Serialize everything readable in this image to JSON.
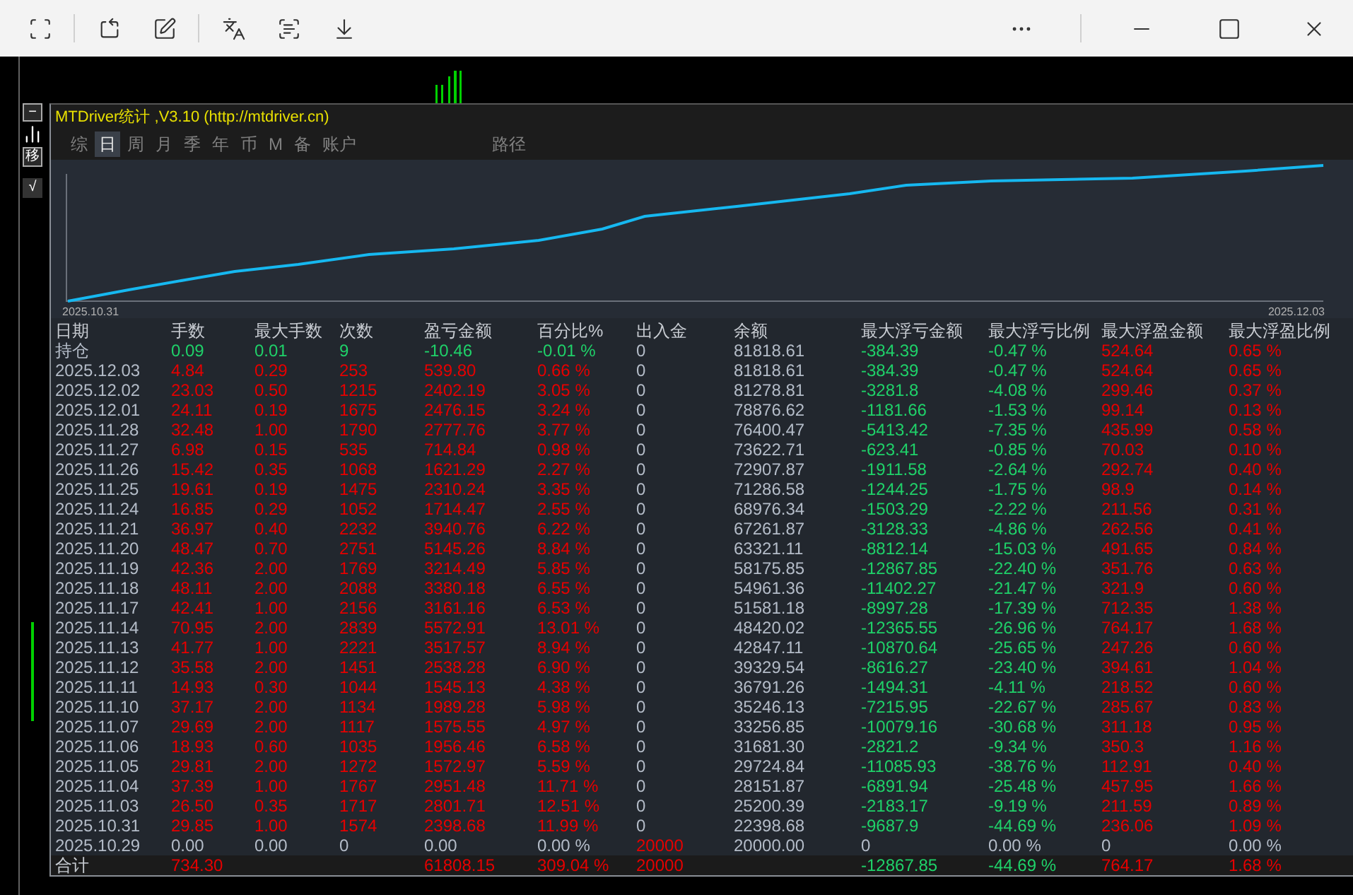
{
  "left_tools": [
    "−",
    "移",
    "√"
  ],
  "panel": {
    "title": "MTDriver统计 ,V3.10 (http://mtdriver.cn)",
    "tabs": [
      {
        "label": "综",
        "selected": false
      },
      {
        "label": "日",
        "selected": true
      },
      {
        "label": "周",
        "selected": false
      },
      {
        "label": "月",
        "selected": false
      },
      {
        "label": "季",
        "selected": false
      },
      {
        "label": "年",
        "selected": false
      },
      {
        "label": "币",
        "selected": false
      },
      {
        "label": "M",
        "selected": false
      },
      {
        "label": "备",
        "selected": false
      },
      {
        "label": "账户",
        "selected": false
      }
    ],
    "path_button": "路径",
    "equity_chart": {
      "start_label": "2025.10.31",
      "end_label": "2025.12.03"
    }
  },
  "table": {
    "columns": [
      "日期",
      "手数",
      "最大手数",
      "次数",
      "盈亏金额",
      "百分比%",
      "出入金",
      "余额",
      "最大浮亏金额",
      "最大浮亏比例",
      "最大浮盈金额",
      "最大浮盈比例"
    ],
    "rows": [
      {
        "kind": "position",
        "cells": [
          "持仓",
          "0.09",
          "0.01",
          "9",
          "-10.46",
          "-0.01 %",
          "0",
          "81818.61",
          "-384.39",
          "-0.47 %",
          "524.64",
          "0.65 %"
        ]
      },
      {
        "kind": "day",
        "cells": [
          "2025.12.03",
          "4.84",
          "0.29",
          "253",
          "539.80",
          "0.66 %",
          "0",
          "81818.61",
          "-384.39",
          "-0.47 %",
          "524.64",
          "0.65 %"
        ]
      },
      {
        "kind": "day",
        "cells": [
          "2025.12.02",
          "23.03",
          "0.50",
          "1215",
          "2402.19",
          "3.05 %",
          "0",
          "81278.81",
          "-3281.8",
          "-4.08 %",
          "299.46",
          "0.37 %"
        ]
      },
      {
        "kind": "day",
        "cells": [
          "2025.12.01",
          "24.11",
          "0.19",
          "1675",
          "2476.15",
          "3.24 %",
          "0",
          "78876.62",
          "-1181.66",
          "-1.53 %",
          "99.14",
          "0.13 %"
        ]
      },
      {
        "kind": "day",
        "cells": [
          "2025.11.28",
          "32.48",
          "1.00",
          "1790",
          "2777.76",
          "3.77 %",
          "0",
          "76400.47",
          "-5413.42",
          "-7.35 %",
          "435.99",
          "0.58 %"
        ]
      },
      {
        "kind": "day",
        "cells": [
          "2025.11.27",
          "6.98",
          "0.15",
          "535",
          "714.84",
          "0.98 %",
          "0",
          "73622.71",
          "-623.41",
          "-0.85 %",
          "70.03",
          "0.10 %"
        ]
      },
      {
        "kind": "day",
        "cells": [
          "2025.11.26",
          "15.42",
          "0.35",
          "1068",
          "1621.29",
          "2.27 %",
          "0",
          "72907.87",
          "-1911.58",
          "-2.64 %",
          "292.74",
          "0.40 %"
        ]
      },
      {
        "kind": "day",
        "cells": [
          "2025.11.25",
          "19.61",
          "0.19",
          "1475",
          "2310.24",
          "3.35 %",
          "0",
          "71286.58",
          "-1244.25",
          "-1.75 %",
          "98.9",
          "0.14 %"
        ]
      },
      {
        "kind": "day",
        "cells": [
          "2025.11.24",
          "16.85",
          "0.29",
          "1052",
          "1714.47",
          "2.55 %",
          "0",
          "68976.34",
          "-1503.29",
          "-2.22 %",
          "211.56",
          "0.31 %"
        ]
      },
      {
        "kind": "day",
        "cells": [
          "2025.11.21",
          "36.97",
          "0.40",
          "2232",
          "3940.76",
          "6.22 %",
          "0",
          "67261.87",
          "-3128.33",
          "-4.86 %",
          "262.56",
          "0.41 %"
        ]
      },
      {
        "kind": "day",
        "cells": [
          "2025.11.20",
          "48.47",
          "0.70",
          "2751",
          "5145.26",
          "8.84 %",
          "0",
          "63321.11",
          "-8812.14",
          "-15.03 %",
          "491.65",
          "0.84 %"
        ]
      },
      {
        "kind": "day",
        "cells": [
          "2025.11.19",
          "42.36",
          "2.00",
          "1769",
          "3214.49",
          "5.85 %",
          "0",
          "58175.85",
          "-12867.85",
          "-22.40 %",
          "351.76",
          "0.63 %"
        ]
      },
      {
        "kind": "day",
        "cells": [
          "2025.11.18",
          "48.11",
          "2.00",
          "2088",
          "3380.18",
          "6.55 %",
          "0",
          "54961.36",
          "-11402.27",
          "-21.47 %",
          "321.9",
          "0.60 %"
        ]
      },
      {
        "kind": "day",
        "cells": [
          "2025.11.17",
          "42.41",
          "1.00",
          "2156",
          "3161.16",
          "6.53 %",
          "0",
          "51581.18",
          "-8997.28",
          "-17.39 %",
          "712.35",
          "1.38 %"
        ]
      },
      {
        "kind": "day",
        "cells": [
          "2025.11.14",
          "70.95",
          "2.00",
          "2839",
          "5572.91",
          "13.01 %",
          "0",
          "48420.02",
          "-12365.55",
          "-26.96 %",
          "764.17",
          "1.68 %"
        ]
      },
      {
        "kind": "day",
        "cells": [
          "2025.11.13",
          "41.77",
          "1.00",
          "2221",
          "3517.57",
          "8.94 %",
          "0",
          "42847.11",
          "-10870.64",
          "-25.65 %",
          "247.26",
          "0.60 %"
        ]
      },
      {
        "kind": "day",
        "cells": [
          "2025.11.12",
          "35.58",
          "2.00",
          "1451",
          "2538.28",
          "6.90 %",
          "0",
          "39329.54",
          "-8616.27",
          "-23.40 %",
          "394.61",
          "1.04 %"
        ]
      },
      {
        "kind": "day",
        "cells": [
          "2025.11.11",
          "14.93",
          "0.30",
          "1044",
          "1545.13",
          "4.38 %",
          "0",
          "36791.26",
          "-1494.31",
          "-4.11 %",
          "218.52",
          "0.60 %"
        ]
      },
      {
        "kind": "day",
        "cells": [
          "2025.11.10",
          "37.17",
          "2.00",
          "1134",
          "1989.28",
          "5.98 %",
          "0",
          "35246.13",
          "-7215.95",
          "-22.67 %",
          "285.67",
          "0.83 %"
        ]
      },
      {
        "kind": "day",
        "cells": [
          "2025.11.07",
          "29.69",
          "2.00",
          "1117",
          "1575.55",
          "4.97 %",
          "0",
          "33256.85",
          "-10079.16",
          "-30.68 %",
          "311.18",
          "0.95 %"
        ]
      },
      {
        "kind": "day",
        "cells": [
          "2025.11.06",
          "18.93",
          "0.60",
          "1035",
          "1956.46",
          "6.58 %",
          "0",
          "31681.30",
          "-2821.2",
          "-9.34 %",
          "350.3",
          "1.16 %"
        ]
      },
      {
        "kind": "day",
        "cells": [
          "2025.11.05",
          "29.81",
          "2.00",
          "1272",
          "1572.97",
          "5.59 %",
          "0",
          "29724.84",
          "-11085.93",
          "-38.76 %",
          "112.91",
          "0.40 %"
        ]
      },
      {
        "kind": "day",
        "cells": [
          "2025.11.04",
          "37.39",
          "1.00",
          "1767",
          "2951.48",
          "11.71 %",
          "0",
          "28151.87",
          "-6891.94",
          "-25.48 %",
          "457.95",
          "1.66 %"
        ]
      },
      {
        "kind": "day",
        "cells": [
          "2025.11.03",
          "26.50",
          "0.35",
          "1717",
          "2801.71",
          "12.51 %",
          "0",
          "25200.39",
          "-2183.17",
          "-9.19 %",
          "211.59",
          "0.89 %"
        ]
      },
      {
        "kind": "day",
        "cells": [
          "2025.10.31",
          "29.85",
          "1.00",
          "1574",
          "2398.68",
          "11.99 %",
          "0",
          "22398.68",
          "-9687.9",
          "-44.69 %",
          "236.06",
          "1.09 %"
        ]
      },
      {
        "kind": "start",
        "cells": [
          "2025.10.29",
          "0.00",
          "0.00",
          "0",
          "0.00",
          "0.00 %",
          "20000",
          "20000.00",
          "0",
          "0.00 %",
          "0",
          "0.00 %"
        ]
      },
      {
        "kind": "total",
        "cells": [
          "合计",
          "734.30",
          null,
          null,
          "61808.15",
          "309.04 %",
          "20000",
          null,
          "-12867.85",
          "-44.69 %",
          "764.17",
          "1.68 %"
        ]
      }
    ]
  }
}
